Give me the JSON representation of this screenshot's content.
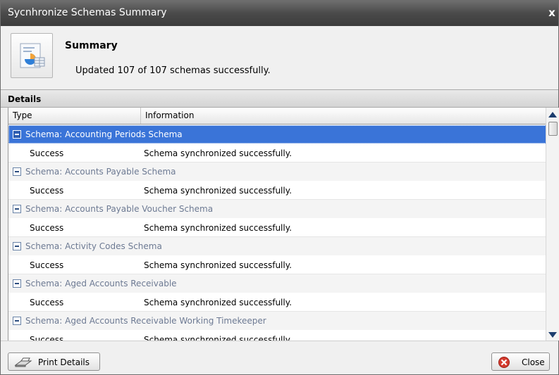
{
  "window": {
    "title": "Sycnhronize Schemas Summary",
    "close_glyph": "x"
  },
  "summary": {
    "icon": "summary-report-icon",
    "heading": "Summary",
    "text": "Updated 107 of 107 schemas successfully."
  },
  "details": {
    "label": "Details",
    "columns": {
      "type": "Type",
      "information": "Information"
    },
    "groups": [
      {
        "label": "Schema: Accounting Periods Schema",
        "selected": true,
        "type": "Success",
        "information": "Schema synchronized successfully."
      },
      {
        "label": "Schema: Accounts Payable Schema",
        "selected": false,
        "type": "Success",
        "information": "Schema synchronized successfully."
      },
      {
        "label": "Schema: Accounts Payable Voucher Schema",
        "selected": false,
        "type": "Success",
        "information": "Schema synchronized successfully."
      },
      {
        "label": "Schema: Activity Codes Schema",
        "selected": false,
        "type": "Success",
        "information": "Schema synchronized successfully."
      },
      {
        "label": "Schema: Aged Accounts Receivable",
        "selected": false,
        "type": "Success",
        "information": "Schema synchronized successfully."
      },
      {
        "label": "Schema: Aged Accounts Receivable Working Timekeeper",
        "selected": false,
        "type": "Success",
        "information": "Schema synchronized successfully."
      }
    ]
  },
  "footer": {
    "print_label": "Print Details",
    "print_icon": "printer-icon",
    "close_label": "Close",
    "close_icon": "close-circle-icon"
  },
  "colors": {
    "selection": "#3a74d8",
    "titlebar": "#4a4a4a",
    "group_text": "#6d7a93"
  }
}
